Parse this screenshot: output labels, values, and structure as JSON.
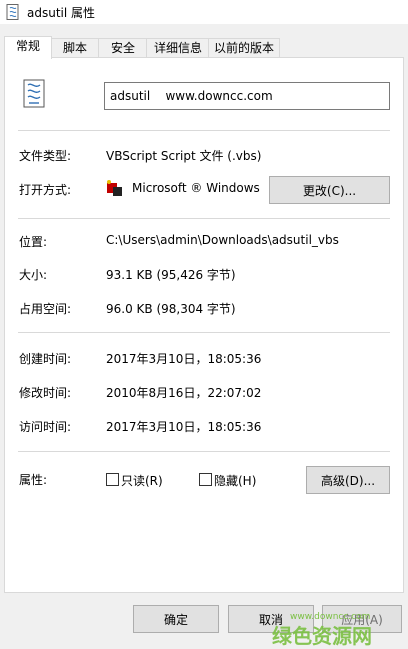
{
  "window": {
    "title": "adsutil 属性"
  },
  "tabs": [
    "常规",
    "安全",
    "详细信息",
    "以前的版本",
    "脚本"
  ],
  "general": {
    "file_name": "adsutil    www.downcc.com",
    "file_type_label": "文件类型:",
    "file_type_value": "VBScript Script 文件 (.vbs)",
    "opens_with_label": "打开方式:",
    "opens_with_value": "Microsoft ® Windows",
    "change_button": "更改(C)...",
    "location_label": "位置:",
    "location_value": "C:\\Users\\admin\\Downloads\\adsutil_vbs",
    "size_label": "大小:",
    "size_value": "93.1 KB (95,426 字节)",
    "size_on_disk_label": "占用空间:",
    "size_on_disk_value": "96.0 KB (98,304 字节)",
    "created_label": "创建时间:",
    "created_value": "2017年3月10日，18:05:36",
    "modified_label": "修改时间:",
    "modified_value": "2010年8月16日，22:07:02",
    "accessed_label": "访问时间:",
    "accessed_value": "2017年3月10日，18:05:36",
    "attributes_label": "属性:",
    "readonly_label": "只读(R)",
    "hidden_label": "隐藏(H)",
    "advanced_button": "高级(D)..."
  },
  "footer": {
    "ok_button": "确定",
    "cancel_button": "取消",
    "apply_button": "应用(A)"
  },
  "watermark": {
    "text": "绿色资源网",
    "sub": "www.downcc.com"
  },
  "colors": {
    "panel_bg": "#ffffff",
    "window_bg": "#f0f0f0",
    "watermark": "#7bc043"
  }
}
